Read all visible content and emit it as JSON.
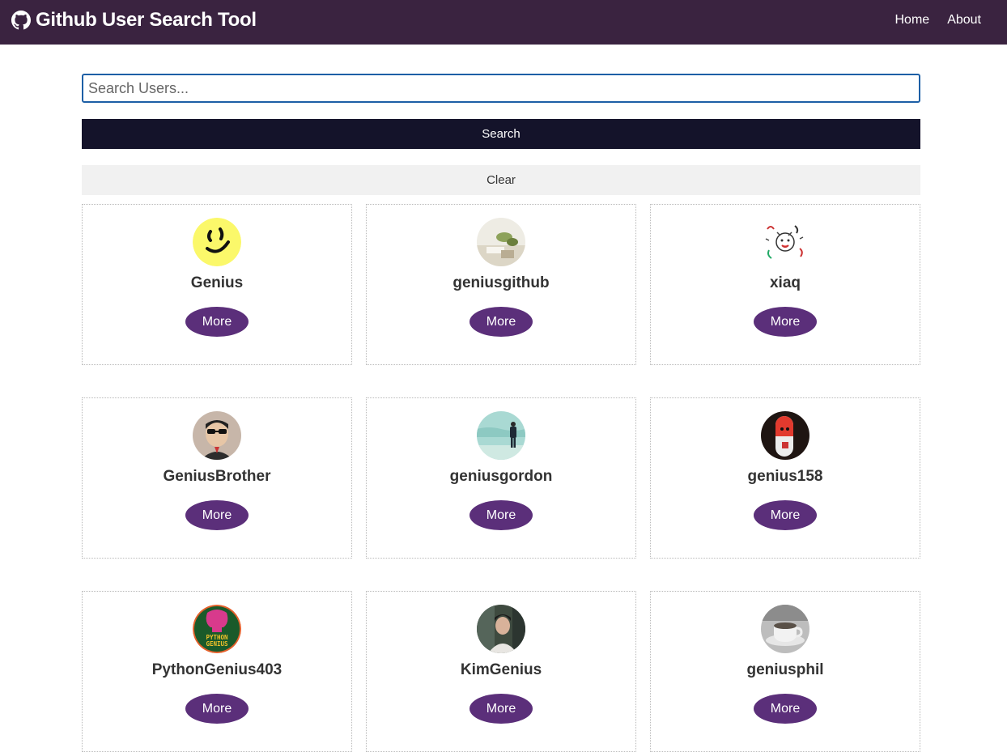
{
  "header": {
    "title": "Github User Search Tool",
    "nav": [
      {
        "label": "Home"
      },
      {
        "label": "About"
      }
    ]
  },
  "search": {
    "placeholder": "Search Users...",
    "value": "",
    "search_label": "Search",
    "clear_label": "Clear"
  },
  "users": [
    {
      "login": "Genius",
      "button": "More",
      "avatar": "yellow-smiley-avatar"
    },
    {
      "login": "geniusgithub",
      "button": "More",
      "avatar": "light-photo-avatar"
    },
    {
      "login": "xiaq",
      "button": "More",
      "avatar": "doodle-avatar"
    },
    {
      "login": "GeniusBrother",
      "button": "More",
      "avatar": "sunglasses-man-avatar"
    },
    {
      "login": "geniusgordon",
      "button": "More",
      "avatar": "beach-person-avatar"
    },
    {
      "login": "genius158",
      "button": "More",
      "avatar": "red-pill-avatar"
    },
    {
      "login": "PythonGenius403",
      "button": "More",
      "avatar": "python-genius-logo-avatar"
    },
    {
      "login": "KimGenius",
      "button": "More",
      "avatar": "person-photo-avatar"
    },
    {
      "login": "geniusphil",
      "button": "More",
      "avatar": "coffee-cup-avatar"
    }
  ],
  "colors": {
    "navbar": "#3a2340",
    "search_button": "#14132a",
    "more_button": "#5b2f7a",
    "input_border": "#1d5fa6"
  }
}
